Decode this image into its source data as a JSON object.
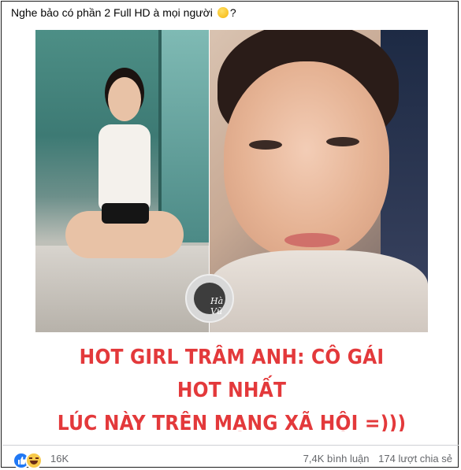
{
  "post": {
    "caption": "Nghe bảo có phần 2 Full HD à mọi người",
    "caption_suffix": "?",
    "caption_emoji": "weary-face-emoji",
    "image": {
      "watermark_text": "Hà Vũ",
      "headline_line1": "HOT GIRL TRÂM ANH: CÔ GÁI HOT NHẤT",
      "headline_line2": "LÚC NÀY TRÊN MẠNG XÃ HỘI =)))",
      "headline_color": "#e3393b"
    }
  },
  "footer": {
    "reaction_icons": [
      "like-icon",
      "haha-icon"
    ],
    "reaction_count": "16K",
    "comments": "7,4K bình luận",
    "shares": "174 lượt chia sẻ"
  }
}
